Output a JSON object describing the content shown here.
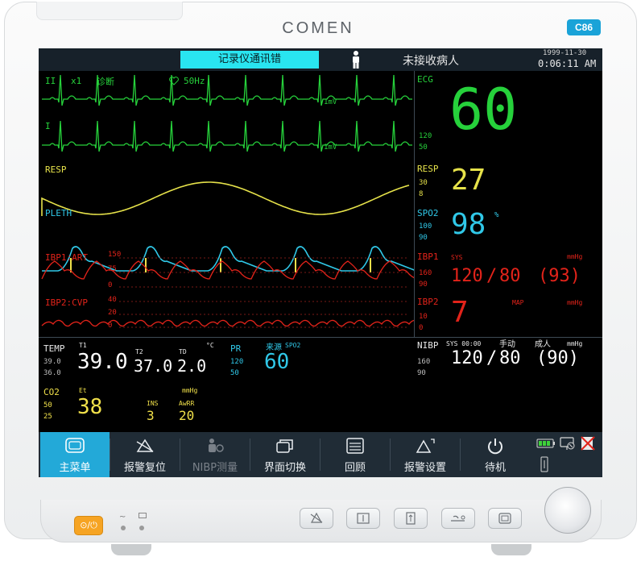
{
  "device": {
    "brand": "COMEN",
    "model": "C86"
  },
  "statusbar": {
    "alarm_message": "记录仪通讯错",
    "patient_status": "未接收病人",
    "date": "1999-11-30",
    "time": "0:06:11 AM"
  },
  "ecg": {
    "lead1_label": "II",
    "gain": "x1",
    "mode": "诊断",
    "filter_icon": "heart-icon",
    "notch": "50Hz",
    "lead2_label": "I",
    "scale1": "1mV",
    "scale2": "1mV",
    "param_label": "ECG",
    "hr_upper": "120",
    "hr_lower": "50",
    "hr_value": "60",
    "color": "#26d13b"
  },
  "resp": {
    "label": "RESP",
    "param_label": "RESP",
    "upper": "30",
    "lower": "8",
    "value": "27",
    "color": "#e6e24a"
  },
  "pleth": {
    "label": "PLETH",
    "param_label": "SPO2",
    "upper": "100",
    "lower": "90",
    "value": "98",
    "unit": "%",
    "color": "#30c8e8"
  },
  "ibp1": {
    "wave_label": "IBP1:ART",
    "scale": [
      "150",
      "75",
      "0"
    ],
    "param_label": "IBP1",
    "sub_label": "SYS",
    "unit": "mmHg",
    "upper": "160",
    "lower": "90",
    "sys": "120",
    "slash": "/",
    "dia": "80",
    "map": "(93)",
    "color": "#e2231a"
  },
  "ibp2": {
    "wave_label": "IBP2:CVP",
    "scale": [
      "40",
      "20",
      "0"
    ],
    "param_label": "IBP2",
    "sub_label": "MAP",
    "unit": "mmHg",
    "upper": "10",
    "lower": "0",
    "value": "7",
    "color": "#e2231a"
  },
  "temp": {
    "label": "TEMP",
    "upper": "39.0",
    "lower": "36.0",
    "t1_label": "T1",
    "t1": "39.0",
    "t2_label": "T2",
    "t2": "37.0",
    "td_label": "TD",
    "td": "2.0",
    "unit": "°C"
  },
  "pr": {
    "label": "PR",
    "source_label": "来源",
    "source": "SPO2",
    "upper": "120",
    "lower": "50",
    "value": "60"
  },
  "nibp": {
    "label": "NIBP",
    "info": "SYS 00:00",
    "mode": "手动",
    "patient_type": "成人",
    "unit": "mmHg",
    "upper": "160",
    "lower": "90",
    "sys": "120",
    "slash": "/",
    "dia": "80",
    "map": "(90)"
  },
  "co2": {
    "label": "CO2",
    "upper": "50",
    "lower": "25",
    "et_label": "Et",
    "et": "38",
    "unit": "mmHg",
    "ins_label": "INS",
    "ins": "3",
    "awrr_label": "AwRR",
    "awrr": "20"
  },
  "menu": {
    "items": [
      {
        "label": "主菜单",
        "icon": "main-menu-icon"
      },
      {
        "label": "报警复位",
        "icon": "alarm-reset-icon"
      },
      {
        "label": "NIBP测量",
        "icon": "nibp-icon"
      },
      {
        "label": "界面切换",
        "icon": "screen-switch-icon"
      },
      {
        "label": "回顾",
        "icon": "review-icon"
      },
      {
        "label": "报警设置",
        "icon": "alarm-setup-icon"
      },
      {
        "label": "待机",
        "icon": "standby-icon"
      }
    ]
  },
  "power_button_label": "⊙/⏻"
}
